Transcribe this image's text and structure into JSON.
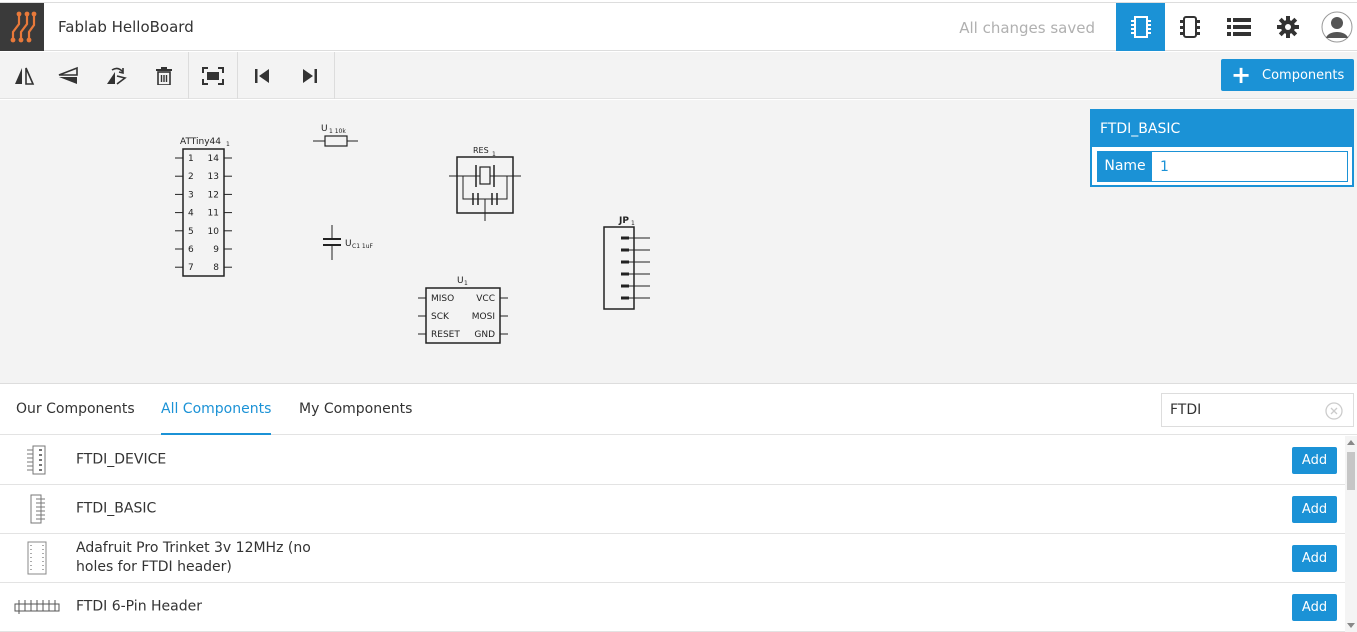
{
  "header": {
    "title": "Fablab HelloBoard",
    "save_status": "All changes saved",
    "icons": [
      "logo-icon",
      "schematic-icon",
      "board-icon",
      "list-icon",
      "gear-icon",
      "avatar-icon"
    ]
  },
  "toolbar": {
    "tools": [
      "flip-horizontal-icon",
      "flip-vertical-icon",
      "rotate-icon",
      "trash-icon",
      "fit-screen-icon",
      "first-icon",
      "last-icon"
    ],
    "components_button": "Components",
    "plus": "+"
  },
  "schematic": {
    "attiny": {
      "label": "ATTiny44",
      "sub": "1",
      "left_pins": [
        "1",
        "2",
        "3",
        "4",
        "5",
        "6",
        "7"
      ],
      "right_pins": [
        "14",
        "13",
        "12",
        "11",
        "10",
        "9",
        "8"
      ]
    },
    "resistor": {
      "label": "U",
      "sub": "1 10k"
    },
    "capacitor": {
      "label": "U",
      "sub": "C1 1uF"
    },
    "resonator": {
      "label": "RES",
      "sub": "1"
    },
    "header": {
      "label": "JP",
      "sub": "1"
    },
    "isp": {
      "label": "U",
      "sub": "1",
      "rows": [
        [
          "MISO",
          "VCC"
        ],
        [
          "SCK",
          "MOSI"
        ],
        [
          "RESET",
          "GND"
        ]
      ]
    }
  },
  "properties": {
    "title": "FTDI_BASIC",
    "name_label": "Name",
    "name_value": "1"
  },
  "tabs": [
    "Our Components",
    "All Components",
    "My Components"
  ],
  "active_tab": "All Components",
  "search": {
    "value": "FTDI"
  },
  "components": [
    {
      "name": "FTDI_DEVICE",
      "add": "Add"
    },
    {
      "name": "FTDI_BASIC",
      "add": "Add"
    },
    {
      "name": "Adafruit Pro Trinket 3v 12MHz (no holes for FTDI header)",
      "add": "Add"
    },
    {
      "name": "FTDI 6-Pin Header",
      "add": "Add"
    }
  ],
  "colors": {
    "accent": "#1b92d6",
    "logo_bg": "#3a3a3a",
    "logo_fg": "#e8793a"
  }
}
